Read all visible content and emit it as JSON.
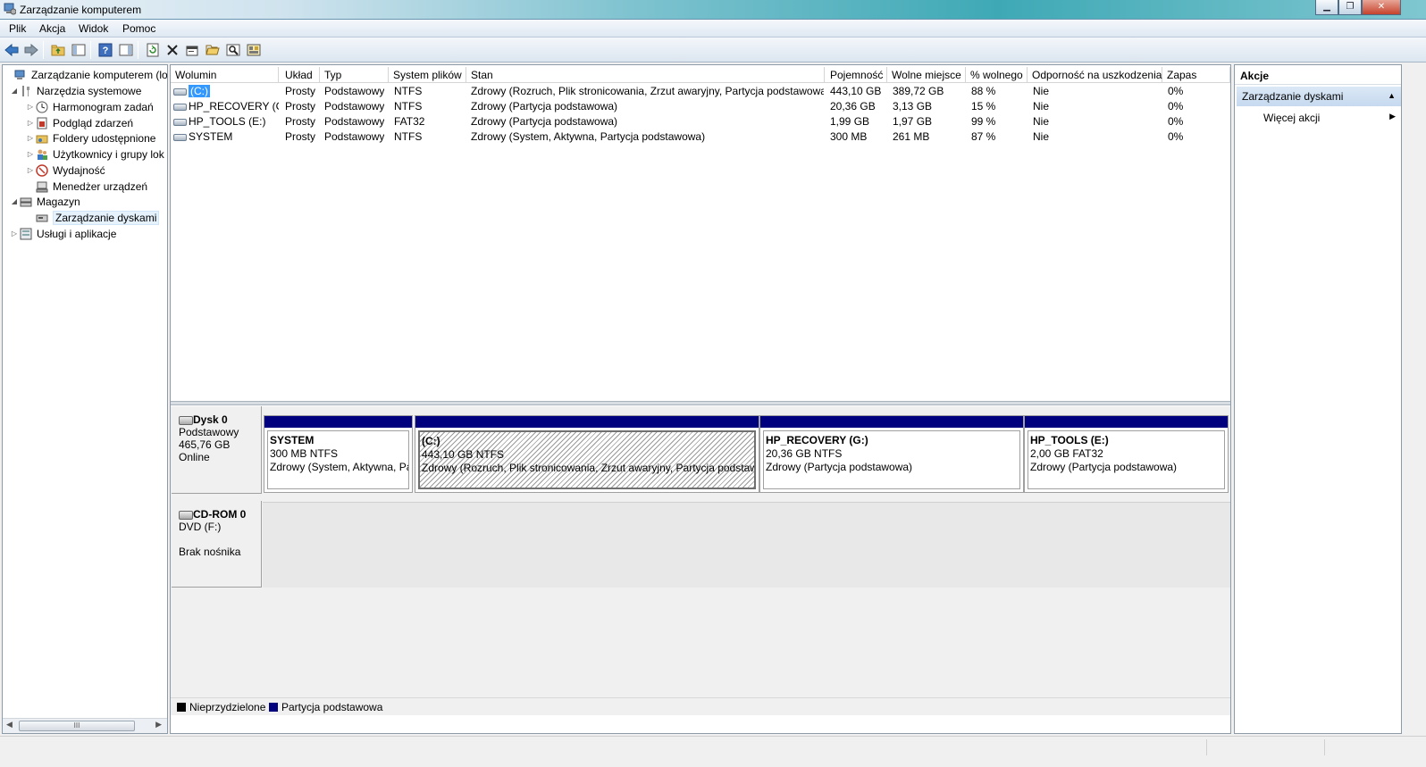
{
  "window": {
    "title": "Zarządzanie komputerem"
  },
  "menu": [
    "Plik",
    "Akcja",
    "Widok",
    "Pomoc"
  ],
  "tree": {
    "items": [
      {
        "label": "Zarządzanie komputerem (loka",
        "icon": "computer-management-icon"
      },
      {
        "label": "Narzędzia systemowe",
        "icon": "tools-icon"
      },
      {
        "label": "Harmonogram zadań",
        "icon": "clock-icon"
      },
      {
        "label": "Podgląd zdarzeń",
        "icon": "event-viewer-icon"
      },
      {
        "label": "Foldery udostępnione",
        "icon": "shared-folder-icon"
      },
      {
        "label": "Użytkownicy i grupy lok",
        "icon": "users-icon"
      },
      {
        "label": "Wydajność",
        "icon": "performance-icon"
      },
      {
        "label": "Menedżer urządzeń",
        "icon": "device-manager-icon"
      },
      {
        "label": "Magazyn",
        "icon": "storage-icon"
      },
      {
        "label": "Zarządzanie dyskami",
        "icon": "disk-management-icon"
      },
      {
        "label": "Usługi i aplikacje",
        "icon": "services-icon"
      }
    ],
    "scroll_thumb": "III"
  },
  "volumes": {
    "columns": [
      "Wolumin",
      "Układ",
      "Typ",
      "System plików",
      "Stan",
      "Pojemność",
      "Wolne miejsce",
      "% wolnego",
      "Odporność na uszkodzenia",
      "Zapas"
    ],
    "rows": [
      {
        "name": "(C:)",
        "layout": "Prosty",
        "type": "Podstawowy",
        "fs": "NTFS",
        "status": "Zdrowy (Rozruch, Plik stronicowania, Zrzut awaryjny, Partycja podstawowa)",
        "capacity": "443,10 GB",
        "free": "389,72 GB",
        "pct": "88 %",
        "fault": "Nie",
        "overhead": "0%"
      },
      {
        "name": "HP_RECOVERY (G:)",
        "layout": "Prosty",
        "type": "Podstawowy",
        "fs": "NTFS",
        "status": "Zdrowy (Partycja podstawowa)",
        "capacity": "20,36 GB",
        "free": "3,13 GB",
        "pct": "15 %",
        "fault": "Nie",
        "overhead": "0%"
      },
      {
        "name": "HP_TOOLS (E:)",
        "layout": "Prosty",
        "type": "Podstawowy",
        "fs": "FAT32",
        "status": "Zdrowy (Partycja podstawowa)",
        "capacity": "1,99 GB",
        "free": "1,97 GB",
        "pct": "99 %",
        "fault": "Nie",
        "overhead": "0%"
      },
      {
        "name": "SYSTEM",
        "layout": "Prosty",
        "type": "Podstawowy",
        "fs": "NTFS",
        "status": "Zdrowy (System, Aktywna, Partycja podstawowa)",
        "capacity": "300 MB",
        "free": "261 MB",
        "pct": "87 %",
        "fault": "Nie",
        "overhead": "0%"
      }
    ]
  },
  "disks": {
    "disk0": {
      "name": "Dysk 0",
      "type": "Podstawowy",
      "size": "465,76 GB",
      "state": "Online",
      "partitions": [
        {
          "name": "SYSTEM",
          "size": "300 MB NTFS",
          "status": "Zdrowy (System, Aktywna, Pa"
        },
        {
          "name": "(C:)",
          "size": "443,10 GB NTFS",
          "status": "Zdrowy (Rozruch, Plik stronicowania, Zrzut awaryjny, Partycja podstawo"
        },
        {
          "name": "HP_RECOVERY  (G:)",
          "size": "20,36 GB NTFS",
          "status": "Zdrowy (Partycja podstawowa)"
        },
        {
          "name": "HP_TOOLS  (E:)",
          "size": "2,00 GB FAT32",
          "status": "Zdrowy (Partycja podstawowa)"
        }
      ]
    },
    "cdrom0": {
      "name": "CD-ROM 0",
      "drive": "DVD (F:)",
      "media": "Brak nośnika"
    }
  },
  "legend": [
    {
      "label": "Nieprzydzielone",
      "color": "#000000"
    },
    {
      "label": "Partycja podstawowa",
      "color": "#00007e"
    }
  ],
  "actions": {
    "header": "Akcje",
    "section": "Zarządzanie dyskami",
    "more": "Więcej akcji"
  },
  "colors": {
    "partition_bar": "#00007e",
    "selection": "#3399ff",
    "actions_section": "#c6d9ef"
  }
}
